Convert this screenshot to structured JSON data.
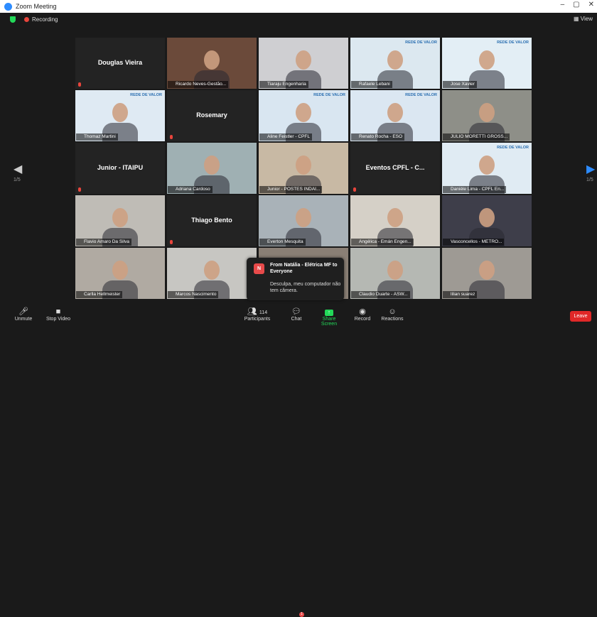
{
  "window": {
    "title": "Zoom Meeting",
    "min": "–",
    "max": "▢",
    "close": "✕"
  },
  "topbar": {
    "recording": "Recording",
    "view": "View"
  },
  "nav": {
    "left_page": "1/5",
    "right_page": "1/5",
    "left_arrow": "◀",
    "right_arrow": "▶"
  },
  "tiles": [
    {
      "name": "Douglas Vieira",
      "video": false
    },
    {
      "name": "Ricardo Neves-Gestão...",
      "video": true,
      "bg": "#6b4a3a"
    },
    {
      "name": "Tiaraju Engenharia",
      "video": true,
      "bg": "#cfcfd2"
    },
    {
      "name": "Rafaele Lebani",
      "video": true,
      "bg": "#dce8f0",
      "banner": "REDE DE VALOR"
    },
    {
      "name": "Jose Xavier",
      "video": true,
      "bg": "#e3eef5",
      "banner": "REDE DE VALOR",
      "active": true
    },
    {
      "name": "Thomaz Martini",
      "video": true,
      "bg": "#dfeaf3",
      "banner": "REDE DE VALOR"
    },
    {
      "name": "Rosemary",
      "video": false
    },
    {
      "name": "Aline Feistler - CPFL",
      "video": true,
      "bg": "#d9e6f1",
      "banner": "REDE DE VALOR"
    },
    {
      "name": "Renato Rocha - ESO",
      "video": true,
      "bg": "#dbe7f2",
      "banner": "REDE DE VALOR"
    },
    {
      "name": "JULIO MORETTI GROSS...",
      "video": true,
      "bg": "#8e8f88"
    },
    {
      "name": "Junior - ITAIPU",
      "video": false
    },
    {
      "name": "Adriana Cardoso",
      "video": true,
      "bg": "#9fb0b3"
    },
    {
      "name": "Junior - POSTES INDAI...",
      "video": true,
      "bg": "#c8b9a4"
    },
    {
      "name": "Eventos CPFL - C...",
      "video": false
    },
    {
      "name": "Danièle Lima - CPFL En...",
      "video": true,
      "bg": "#e0ebf3",
      "banner": "REDE DE VALOR"
    },
    {
      "name": "Flavio Amaro Da Silva",
      "video": true,
      "bg": "#bfbcb6"
    },
    {
      "name": "Thiago Bento",
      "video": false
    },
    {
      "name": "Everton Mesquita",
      "video": true,
      "bg": "#a9b2b8"
    },
    {
      "name": "Angélica - Emán Engen...",
      "video": true,
      "bg": "#d5d0c7"
    },
    {
      "name": "Vasconcellos - METRO...",
      "video": true,
      "bg": "#3e3e4a"
    },
    {
      "name": "Carlla Hellmeister",
      "video": true,
      "bg": "#b0aaa2"
    },
    {
      "name": "Marcos Nascimento",
      "video": true,
      "bg": "#c7c6c2"
    },
    {
      "name": "",
      "video": true,
      "bg": "#8a7f75",
      "hidden_by_toast": true
    },
    {
      "name": "Claudio Duarte - ASW...",
      "video": true,
      "bg": "#b5b8b3"
    },
    {
      "name": "lilian suarez",
      "video": true,
      "bg": "#9e9a94"
    }
  ],
  "toast": {
    "initial": "N",
    "from": "From Natália - Elétrica MF to Everyone",
    "message": "Desculpa, meu computador não tem câmera."
  },
  "toolbar": {
    "unmute": "Unmute",
    "stop_video": "Stop Video",
    "participants": "Participants",
    "participants_count": "114",
    "chat": "Chat",
    "chat_badge": "1",
    "share_screen": "Share Screen",
    "record": "Record",
    "reactions": "Reactions",
    "leave": "Leave"
  },
  "colors": {
    "accent": "#2d8cff",
    "share": "#23d959",
    "leave": "#e02828",
    "active_speaker": "#c7e000"
  }
}
